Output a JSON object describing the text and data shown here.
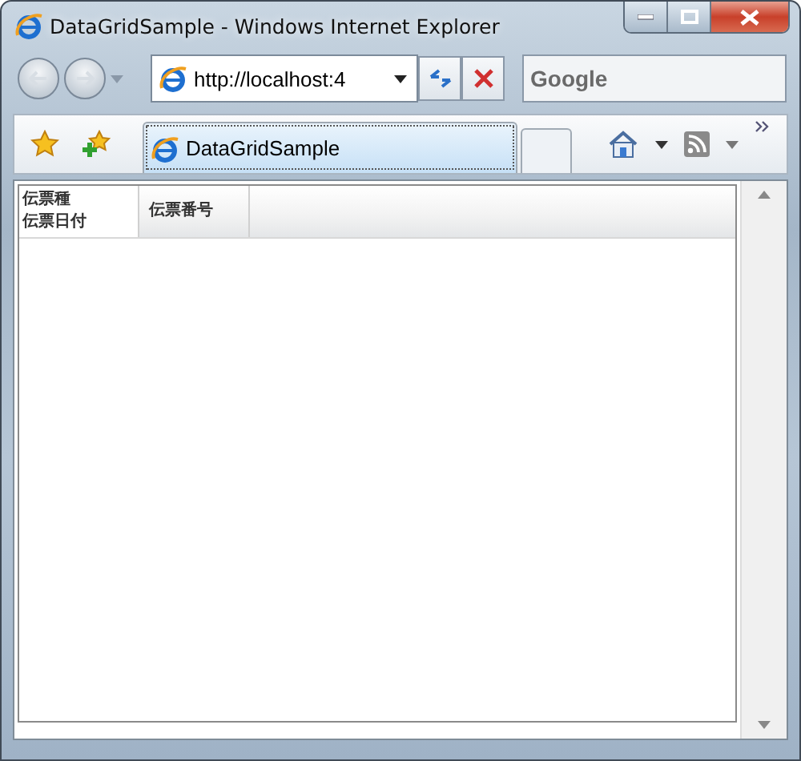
{
  "window": {
    "title": "DataGridSample - Windows Internet Explorer"
  },
  "address_bar": {
    "value": "http://localhost:4"
  },
  "search": {
    "placeholder": "Google"
  },
  "tabs": [
    {
      "label": "DataGridSample",
      "selected": true
    }
  ],
  "grid": {
    "columns": [
      {
        "lines": [
          "伝票種",
          "伝票日付"
        ]
      },
      {
        "lines": [
          "伝票番号"
        ]
      }
    ]
  }
}
